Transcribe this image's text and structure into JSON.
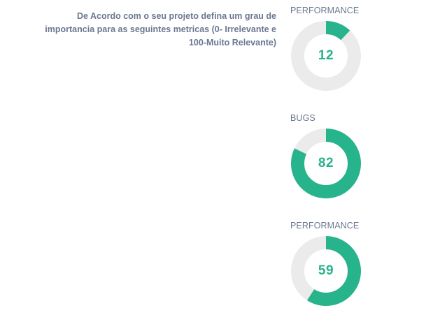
{
  "question": {
    "text": "De Acordo com o seu projeto defina um grau de importancia para as seguintes metricas (0- Irrelevante e 100-Muito Relevante)"
  },
  "metrics": [
    {
      "label": "PERFORMANCE",
      "value": 12
    },
    {
      "label": "BUGS",
      "value": 82
    },
    {
      "label": "PERFORMANCE",
      "value": 59
    }
  ],
  "colors": {
    "accent": "#27b38c",
    "track": "#ebebeb",
    "text": "#6b7890"
  }
}
